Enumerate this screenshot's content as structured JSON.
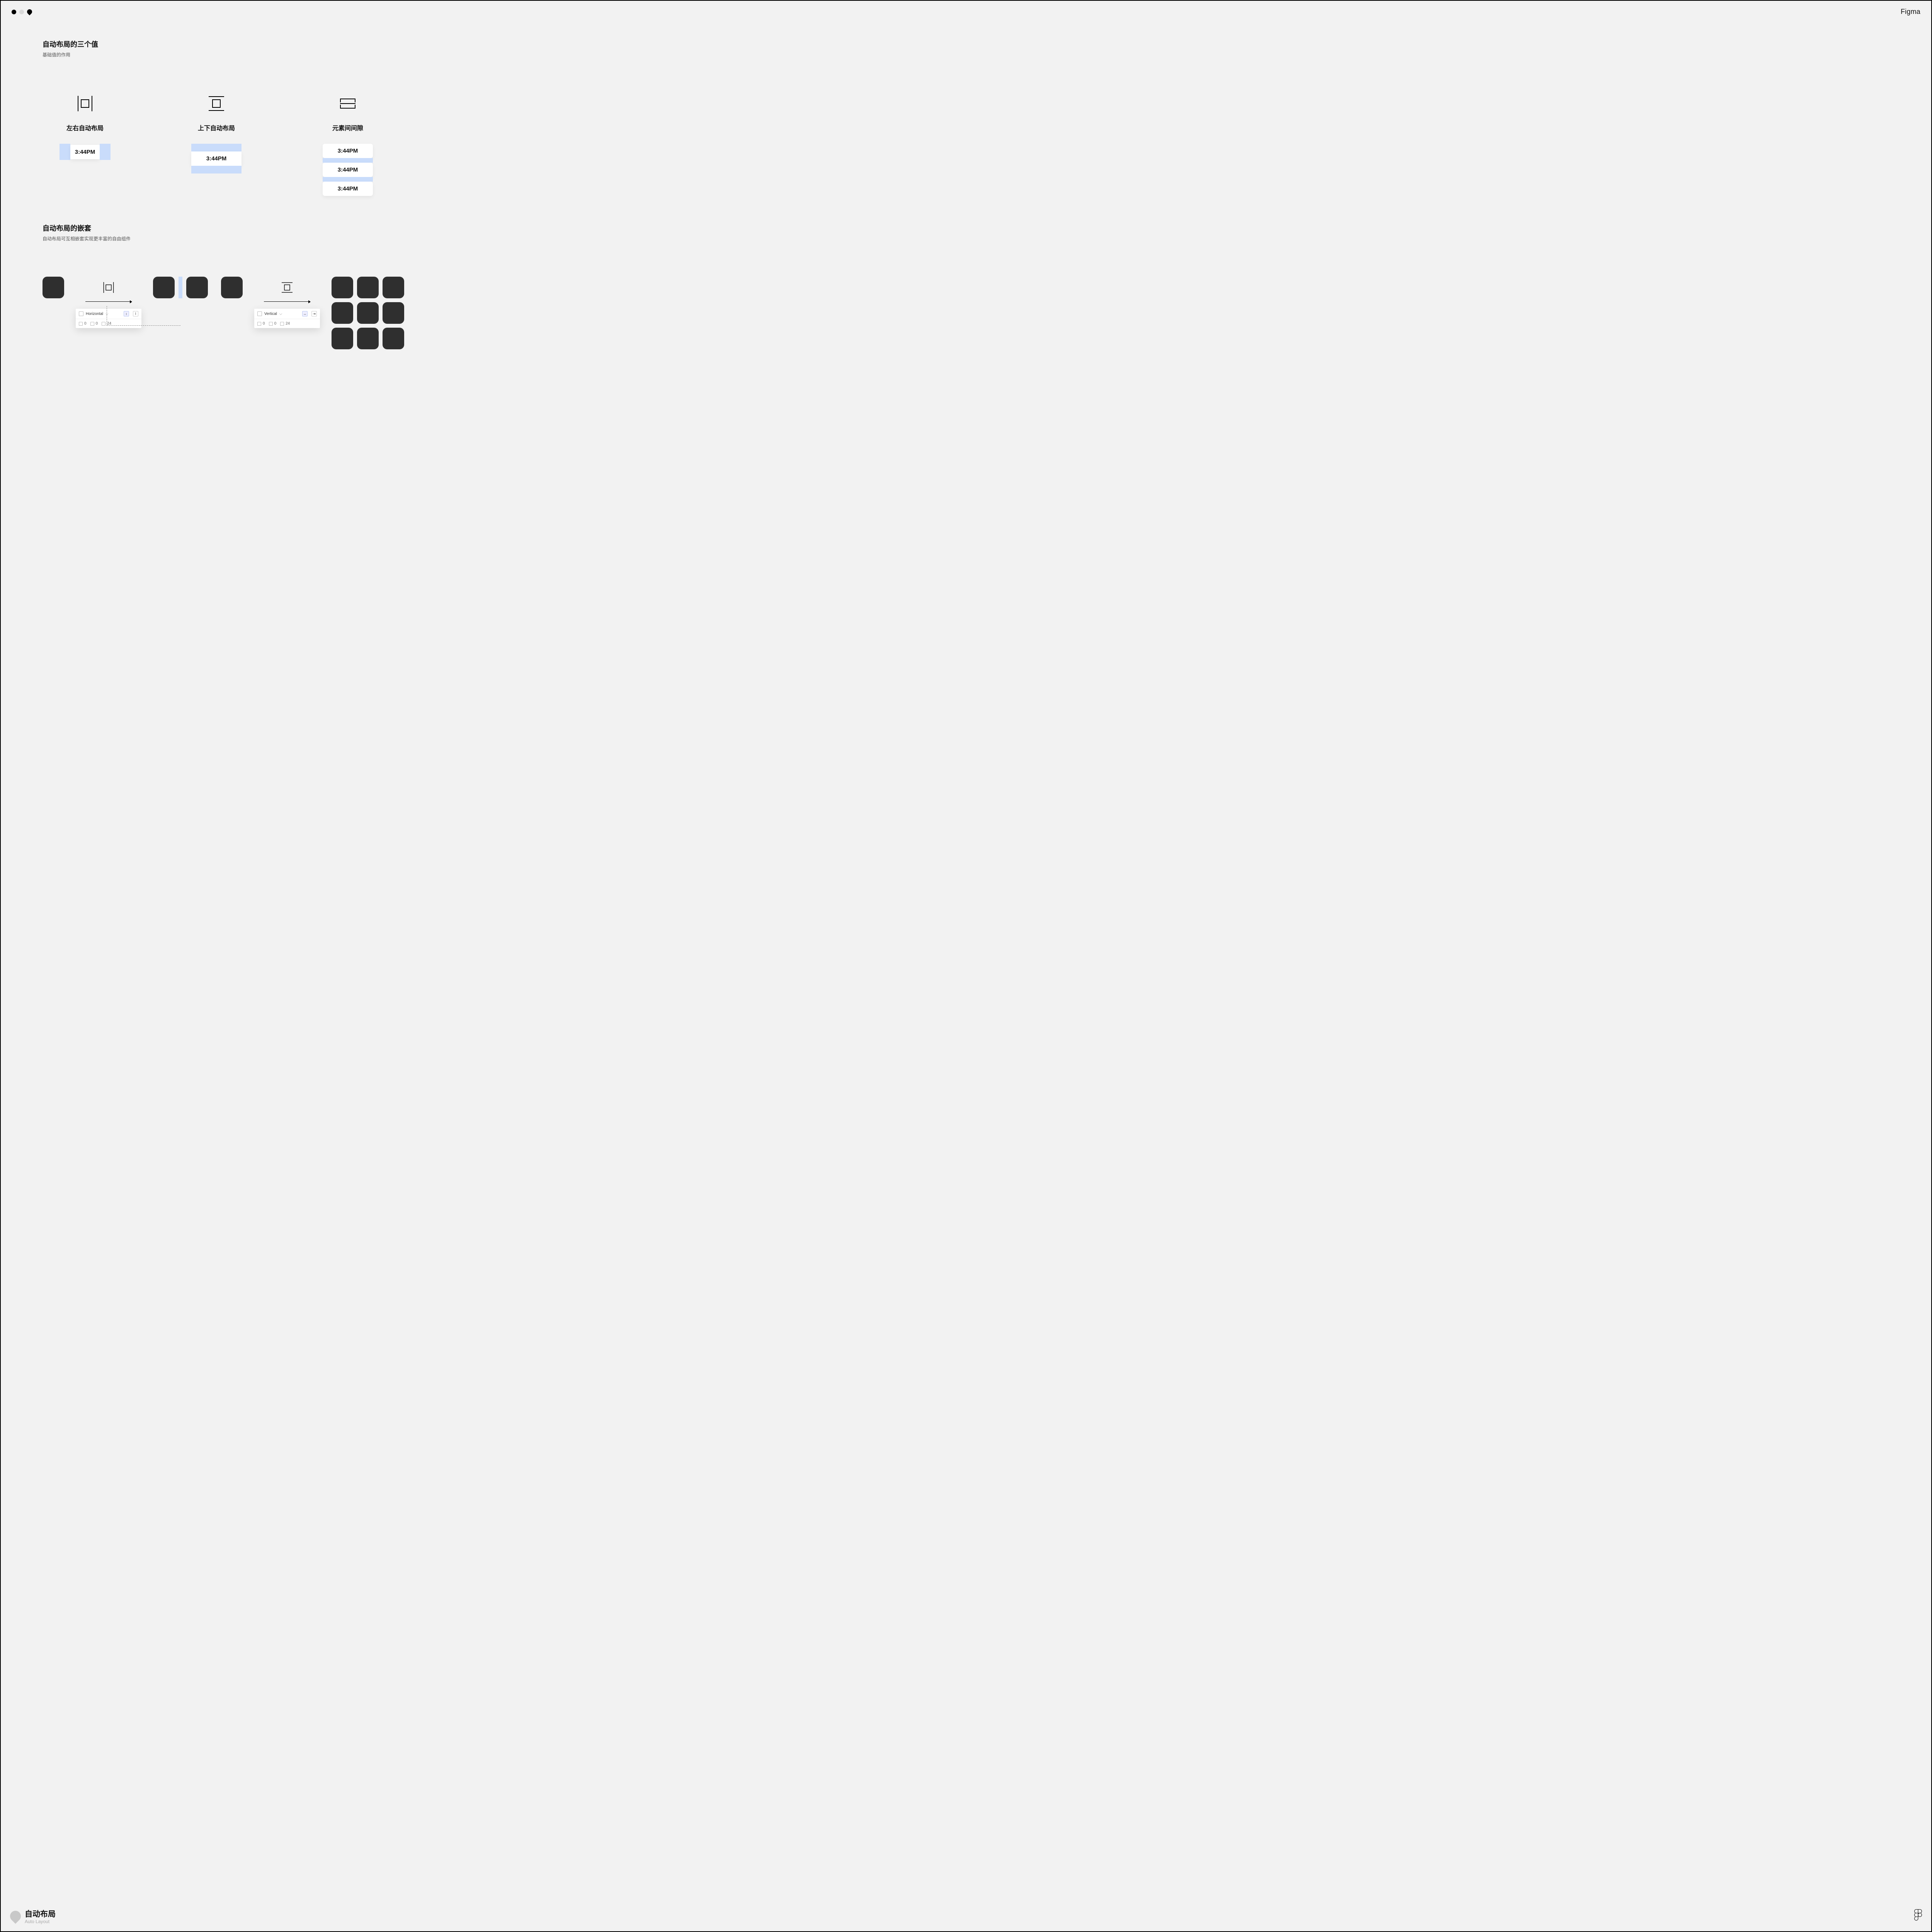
{
  "brand": "Figma",
  "section1": {
    "title": "自动布局的三个值",
    "subtitle": "基础值的作用",
    "cols": [
      {
        "title": "左右自动布局",
        "chip": "3:44PM"
      },
      {
        "title": "上下自动布局",
        "chip": "3:44PM"
      },
      {
        "title": "元素间间隙",
        "chips": [
          "3:44PM",
          "3:44PM",
          "3:44PM"
        ]
      }
    ]
  },
  "section2": {
    "title": "自动布局的嵌套",
    "subtitle": "自动布局可互相嵌套实现更丰富的自由组件"
  },
  "panels": {
    "horizontal": {
      "direction": "Horizontal",
      "padH": "0",
      "padV": "0",
      "gap": "24"
    },
    "vertical": {
      "direction": "Vertical",
      "padH": "0",
      "padV": "0",
      "gap": "24"
    }
  },
  "footer": {
    "title": "自动布局",
    "subtitle": "Auto Layout"
  }
}
